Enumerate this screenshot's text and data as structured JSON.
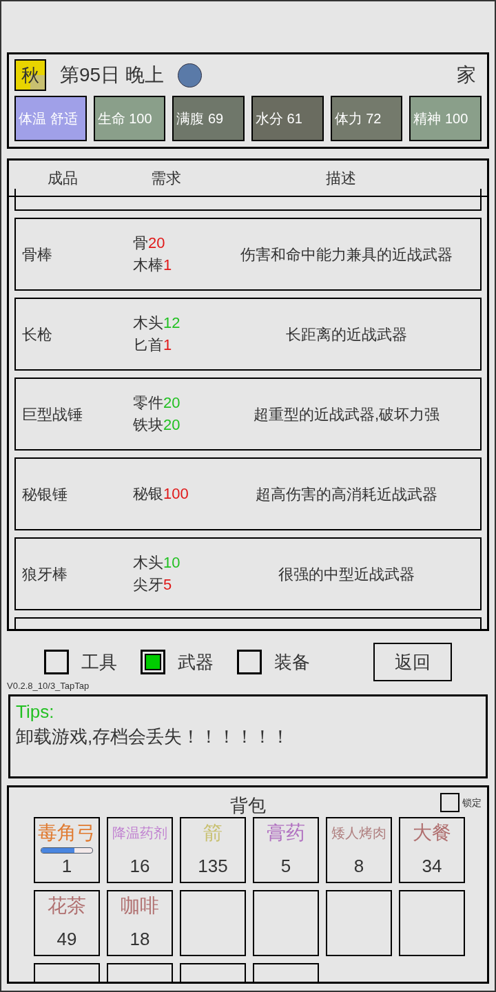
{
  "header": {
    "season": "秋",
    "day": "第95日 晚上",
    "location": "家",
    "stats": [
      {
        "label": "体温 舒适",
        "color": "#a0a0e8"
      },
      {
        "label": "生命 100",
        "color": "#8a9f8a"
      },
      {
        "label": "满腹 69",
        "color": "#6f776a"
      },
      {
        "label": "水分 61",
        "color": "#6a6c60"
      },
      {
        "label": "体力 72",
        "color": "#747a6c"
      },
      {
        "label": "精神 100",
        "color": "#8a9f8a"
      }
    ]
  },
  "crafting": {
    "columns": [
      "成品",
      "需求",
      "描述"
    ],
    "rows": [
      {
        "product": "骨棒",
        "requirements": [
          {
            "name": "骨",
            "amount": "20",
            "enough": false
          },
          {
            "name": "木棒",
            "amount": "1",
            "enough": false
          }
        ],
        "description": "伤害和命中能力兼具的近战武器"
      },
      {
        "product": "长枪",
        "requirements": [
          {
            "name": "木头",
            "amount": "12",
            "enough": true
          },
          {
            "name": "匕首",
            "amount": "1",
            "enough": false
          }
        ],
        "description": "长距离的近战武器"
      },
      {
        "product": "巨型战锤",
        "requirements": [
          {
            "name": "零件",
            "amount": "20",
            "enough": true
          },
          {
            "name": "铁块",
            "amount": "20",
            "enough": true
          }
        ],
        "description": "超重型的近战武器,破坏力强"
      },
      {
        "product": "秘银锤",
        "requirements": [
          {
            "name": "秘银",
            "amount": "100",
            "enough": false
          }
        ],
        "description": "超高伤害的高消耗近战武器"
      },
      {
        "product": "狼牙棒",
        "requirements": [
          {
            "name": "木头",
            "amount": "10",
            "enough": true
          },
          {
            "name": "尖牙",
            "amount": "5",
            "enough": false
          }
        ],
        "description": "很强的中型近战武器"
      }
    ]
  },
  "filters": [
    {
      "label": "工具",
      "selected": false
    },
    {
      "label": "武器",
      "selected": true
    },
    {
      "label": "装备",
      "selected": false
    }
  ],
  "back_button": "返回",
  "version": "V0.2.8_10/3_TapTap",
  "tips": {
    "title": "Tips:",
    "text": "卸载游戏,存档会丢失！！！！！！"
  },
  "backpack": {
    "title": "背包",
    "lock": {
      "label": "锁定",
      "checked": false
    },
    "slots": [
      {
        "kind": "item",
        "name": "毒角弓",
        "count": "1",
        "color": "#e07a30",
        "level": 0.65
      },
      {
        "kind": "item",
        "name": "降温药剂",
        "count": "16",
        "color": "#c080d0",
        "small": true
      },
      {
        "kind": "item",
        "name": "箭",
        "count": "135",
        "color": "#c8c070"
      },
      {
        "kind": "item",
        "name": "膏药",
        "count": "5",
        "color": "#b070c0"
      },
      {
        "kind": "item",
        "name": "矮人烤肉",
        "count": "8",
        "color": "#b08080",
        "small": true
      },
      {
        "kind": "item",
        "name": "大餐",
        "count": "34",
        "color": "#b07070"
      },
      {
        "kind": "item",
        "name": "花茶",
        "count": "49",
        "color": "#b07070"
      },
      {
        "kind": "item",
        "name": "咖啡",
        "count": "18",
        "color": "#b07070"
      },
      {
        "kind": "empty"
      },
      {
        "kind": "empty"
      },
      {
        "kind": "empty"
      },
      {
        "kind": "empty"
      },
      {
        "kind": "empty"
      },
      {
        "kind": "empty"
      },
      {
        "kind": "empty"
      },
      {
        "kind": "empty"
      }
    ]
  }
}
